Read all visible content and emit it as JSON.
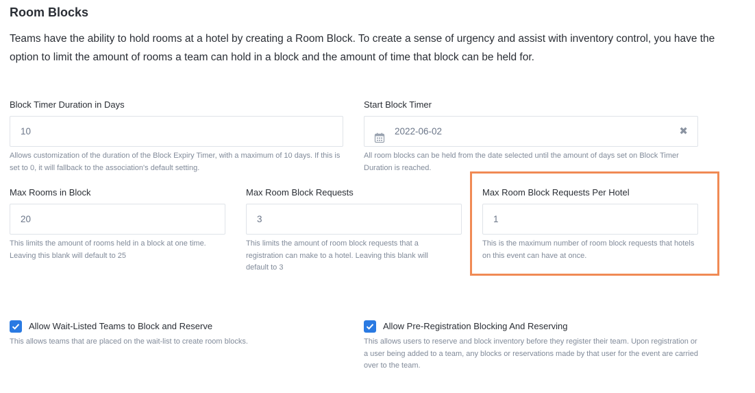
{
  "section": {
    "title": "Room Blocks",
    "intro": "Teams have the ability to hold rooms at a hotel by creating a Room Block. To create a sense of urgency and assist with inventory control, you have the option to limit the amount of rooms a team can hold in a block and the amount of time that block can be held for."
  },
  "fields": {
    "block_timer_duration": {
      "label": "Block Timer Duration in Days",
      "value": "10",
      "help": "Allows customization of the duration of the Block Expiry Timer, with a maximum of 10 days. If this is set to 0, it will fallback to the association's default setting."
    },
    "start_block_timer": {
      "label": "Start Block Timer",
      "value": "2022-06-02",
      "help": "All room blocks can be held from the date selected until the amount of days set on Block Timer Duration is reached."
    },
    "max_rooms_in_block": {
      "label": "Max Rooms in Block",
      "value": "20",
      "help": "This limits the amount of rooms held in a block at one time. Leaving this blank will default to 25"
    },
    "max_room_block_requests": {
      "label": "Max Room Block Requests",
      "value": "3",
      "help": "This limits the amount of room block requests that a registration can make to a hotel. Leaving this blank will default to 3"
    },
    "max_requests_per_hotel": {
      "label": "Max Room Block Requests Per Hotel",
      "value": "1",
      "help": "This is the maximum number of room block requests that hotels on this event can have at once."
    }
  },
  "checkboxes": {
    "wait_listed": {
      "label": "Allow Wait-Listed Teams to Block and Reserve",
      "checked": true,
      "help": "This allows teams that are placed on the wait-list to create room blocks."
    },
    "pre_registration": {
      "label": "Allow Pre-Registration Blocking And Reserving",
      "checked": true,
      "help": "This allows users to reserve and block inventory before they register their team. Upon registration or a user being added to a team, any blocks or reservations made by that user for the event are carried over to the team."
    }
  },
  "icons": {
    "calendar": "calendar-icon",
    "clear": "close-icon",
    "check": "check-icon"
  },
  "colors": {
    "highlight": "#f08a54",
    "checkbox": "#2a7ae2",
    "help_text": "#808a99"
  }
}
